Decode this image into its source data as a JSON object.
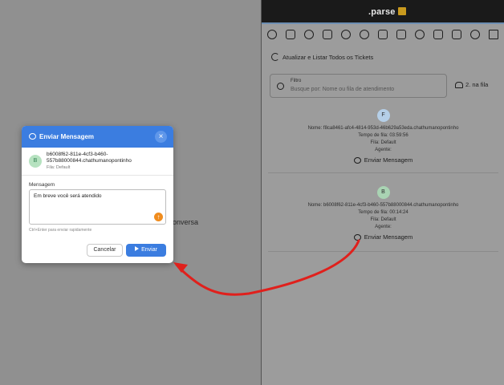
{
  "background": {
    "left_text": "onversa"
  },
  "app": {
    "logo": ".parse"
  },
  "toolbar": {
    "icons": [
      "chat-icon",
      "calendar-icon",
      "chart-icon",
      "contacts-icon",
      "tag-icon",
      "users-icon",
      "file-icon",
      "megaphone-icon",
      "sparkle-icon",
      "report-icon",
      "ticket-icon",
      "bulb-icon",
      "transfer-icon"
    ]
  },
  "tickets_panel": {
    "refresh_label": "Atualizar e Listar Todos os Tickets",
    "filter_label": "Filtro",
    "filter_placeholder": "Busque por: Nome ou fila de atendimento",
    "queue_label": "2. na fila",
    "tickets": [
      {
        "avatar": "F",
        "name": "Nome: f8ca8461-afc4-4814-953d-46b629a53eda.chathumanopontinho",
        "wait": "Tempo de fila: 03:59:56",
        "queue": "Fila: Default",
        "agent": "Agente:",
        "action": "Enviar Mensagem"
      },
      {
        "avatar": "B",
        "name": "Nome: b6008f62-811e-4cf3-b460-557b88000844.chathumanopontinho",
        "wait": "Tempo de fila: 00:14:24",
        "queue": "Fila: Default",
        "agent": "Agente:",
        "action": "Enviar Mensagem"
      }
    ]
  },
  "modal": {
    "title": "Enviar Mensagem",
    "close": "×",
    "contact_avatar": "B",
    "contact_name": "b6008f62-811e-4cf3-b460-557b88000844.chathumanopontinho",
    "contact_queue": "Fila: Default",
    "message_label": "Mensagem",
    "message_value": "Em breve você será atendido",
    "hint": "Ctrl+Enter para enviar rapidamente",
    "cancel_label": "Cancelar",
    "send_label": "Enviar"
  },
  "colors": {
    "accent": "#3b7de0",
    "annotation_arrow": "#e0201c"
  }
}
